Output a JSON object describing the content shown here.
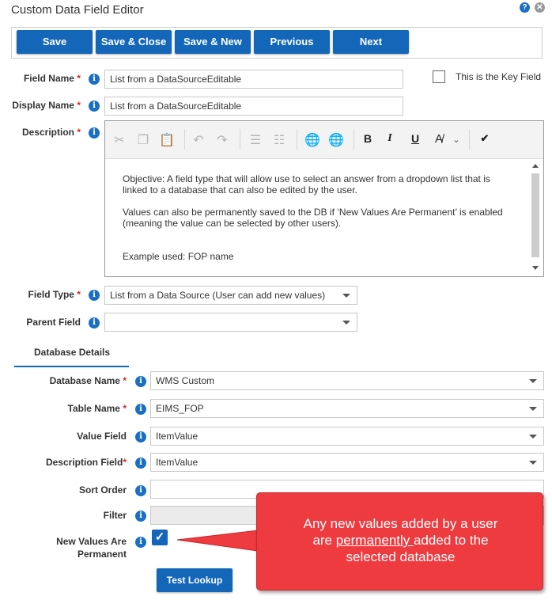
{
  "window": {
    "title": "Custom Data Field Editor",
    "help_icon": "question-circle-icon",
    "close_icon": "close-circle-icon"
  },
  "toolbar": {
    "save": "Save",
    "save_close": "Save & Close",
    "save_new": "Save & New",
    "previous": "Previous",
    "next": "Next"
  },
  "colors": {
    "primary_button": "#1467b8",
    "info_icon": "#1a6fc4",
    "required_star": "#d22222",
    "callout": "#ee3b40"
  },
  "fields": {
    "field_name": {
      "label": "Field Name",
      "value": "List from a DataSourceEditable"
    },
    "key_field": {
      "label": "This is the Key Field",
      "checked": false
    },
    "display_name": {
      "label": "Display Name",
      "value": "List from a DataSourceEditable"
    },
    "description": {
      "label": "Description",
      "paragraphs": [
        "Objective: A field type that will allow use to select an answer from a dropdown list that is linked to a database that can also be edited by the user.",
        "Values can also be permanently saved to the DB if ‘New Values Are Permanent’ is enabled (meaning the value can be selected by other users).",
        "Example used: FOP name"
      ]
    },
    "field_type": {
      "label": "Field Type",
      "value": "List from a Data Source (User can add new values)"
    },
    "parent_field": {
      "label": "Parent Field",
      "value": ""
    }
  },
  "editor_toolbar": [
    "cut-icon",
    "copy-icon",
    "paste-icon",
    "undo-icon",
    "redo-icon",
    "numbered-list-icon",
    "bullet-list-icon",
    "link-icon",
    "unlink-icon",
    "bold-icon",
    "italic-icon",
    "underline-icon",
    "text-color-icon",
    "spellcheck-icon"
  ],
  "section": {
    "tab": "Database Details"
  },
  "db": {
    "database_name": {
      "label": "Database Name",
      "value": "WMS Custom"
    },
    "table_name": {
      "label": "Table Name",
      "value": "EIMS_FOP"
    },
    "value_field": {
      "label": "Value Field",
      "value": "ItemValue"
    },
    "description_field": {
      "label": "Description Field",
      "value": "ItemValue"
    },
    "sort_order": {
      "label": "Sort Order",
      "value": ""
    },
    "filter": {
      "label": "Filter",
      "value": ""
    },
    "new_values_permanent": {
      "label_line1": "New Values Are",
      "label_line2": "Permanent",
      "checked": true
    }
  },
  "test_lookup": "Test Lookup",
  "callout": {
    "line1": "Any new values added by a user",
    "line2_pre": "are ",
    "line2_underlined": "permanently ",
    "line2_post": "added to the",
    "line3": "selected database"
  }
}
